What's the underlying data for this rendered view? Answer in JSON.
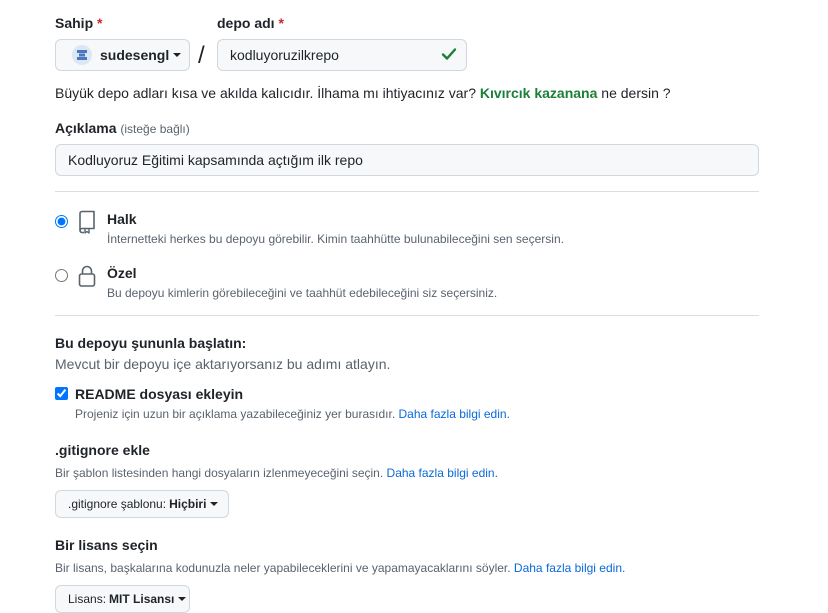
{
  "owner": {
    "label": "Sahip",
    "required_mark": "*",
    "name": "sudesengl"
  },
  "repo": {
    "label": "depo adı",
    "required_mark": "*",
    "value": "kodluyoruzilkrepo",
    "separator": "/"
  },
  "hint": {
    "text": "Büyük depo adları kısa ve akılda kalıcıdır. İlhama mı ihtiyacınız var?",
    "suggestion": "Kıvırcık kazanana",
    "suffix": "ne dersin ?"
  },
  "description": {
    "label": "Açıklama",
    "optional": "(isteğe bağlı)",
    "value": "Kodluyoruz Eğitimi kapsamında açtığım ilk repo"
  },
  "visibility": {
    "public": {
      "title": "Halk",
      "desc": "İnternetteki herkes bu depoyu görebilir. Kimin taahhütte bulunabileceğini sen seçersin.",
      "selected": true
    },
    "private": {
      "title": "Özel",
      "desc": "Bu depoyu kimlerin görebileceğini ve taahhüt edebileceğini siz seçersiniz.",
      "selected": false
    }
  },
  "init": {
    "title": "Bu depoyu şununla başlatın:",
    "subtitle": "Mevcut bir depoyu içe aktarıyorsanız bu adımı atlayın."
  },
  "readme": {
    "label": "README dosyası ekleyin",
    "desc": "Projeniz için uzun bir açıklama yazabileceğiniz yer burasıdır.",
    "link": "Daha fazla bilgi edin.",
    "checked": true
  },
  "gitignore": {
    "title": ".gitignore ekle",
    "desc": "Bir şablon listesinden hangi dosyaların izlenmeyeceğini seçin.",
    "link": "Daha fazla bilgi edin.",
    "dropdown_label": ".gitignore şablonu:",
    "dropdown_value": "Hiçbiri"
  },
  "license": {
    "title": "Bir lisans seçin",
    "desc": "Bir lisans, başkalarına kodunuzla neler yapabileceklerini ve yapamayacaklarını söyler.",
    "link": "Daha fazla bilgi edin.",
    "dropdown_label": "Lisans:",
    "dropdown_value": "MIT Lisansı"
  },
  "colors": {
    "accent": "#0969da",
    "success": "#1a7f37",
    "danger": "#d1242f"
  }
}
